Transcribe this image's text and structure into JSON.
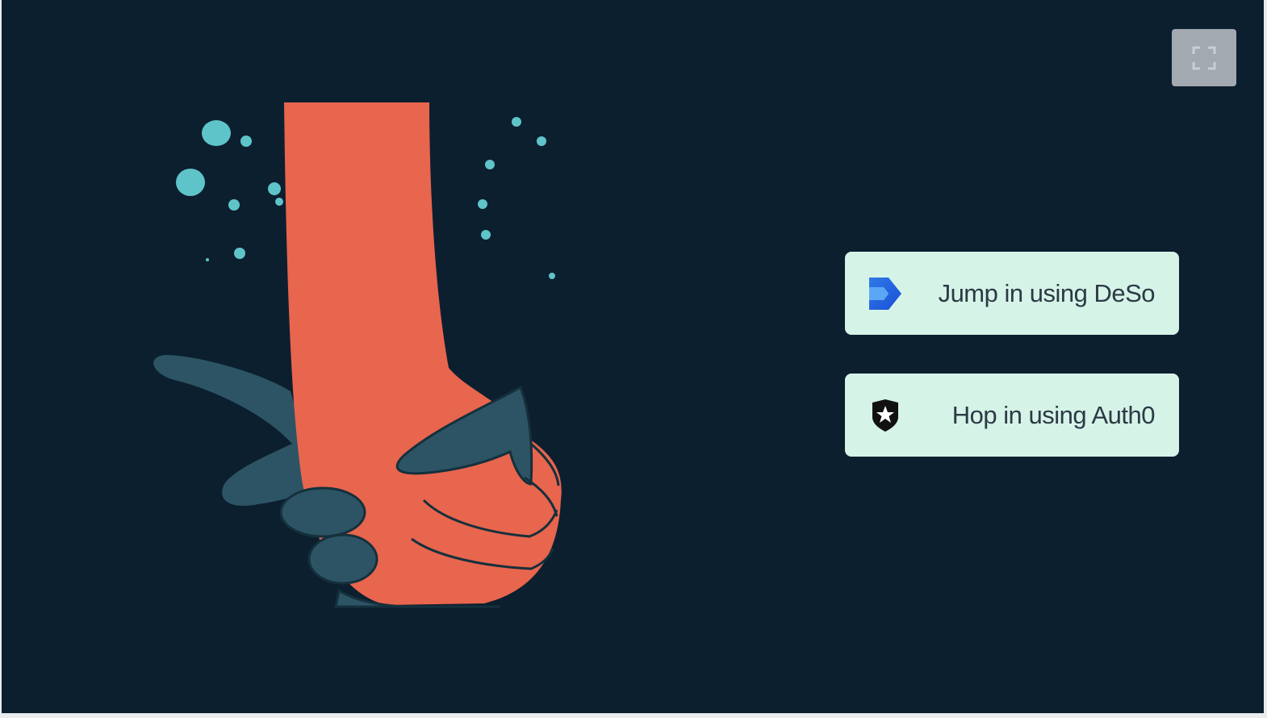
{
  "colors": {
    "background": "#0c1f2f",
    "button_background": "#d6f3e8",
    "button_text": "#2b3a44",
    "fullscreen_button": "#a3a9b1",
    "illustration_arm": "#e8654e",
    "illustration_hand": "#2c5464",
    "illustration_bubbles": "#5fc4c9"
  },
  "controls": {
    "fullscreen_icon": "fullscreen-icon"
  },
  "illustration": {
    "icon": "hand-gripping-arm-illustration"
  },
  "login": {
    "buttons": [
      {
        "label": "Jump in using DeSo",
        "icon": "deso-logo-icon"
      },
      {
        "label": "Hop in using Auth0",
        "icon": "auth0-logo-icon"
      }
    ]
  }
}
